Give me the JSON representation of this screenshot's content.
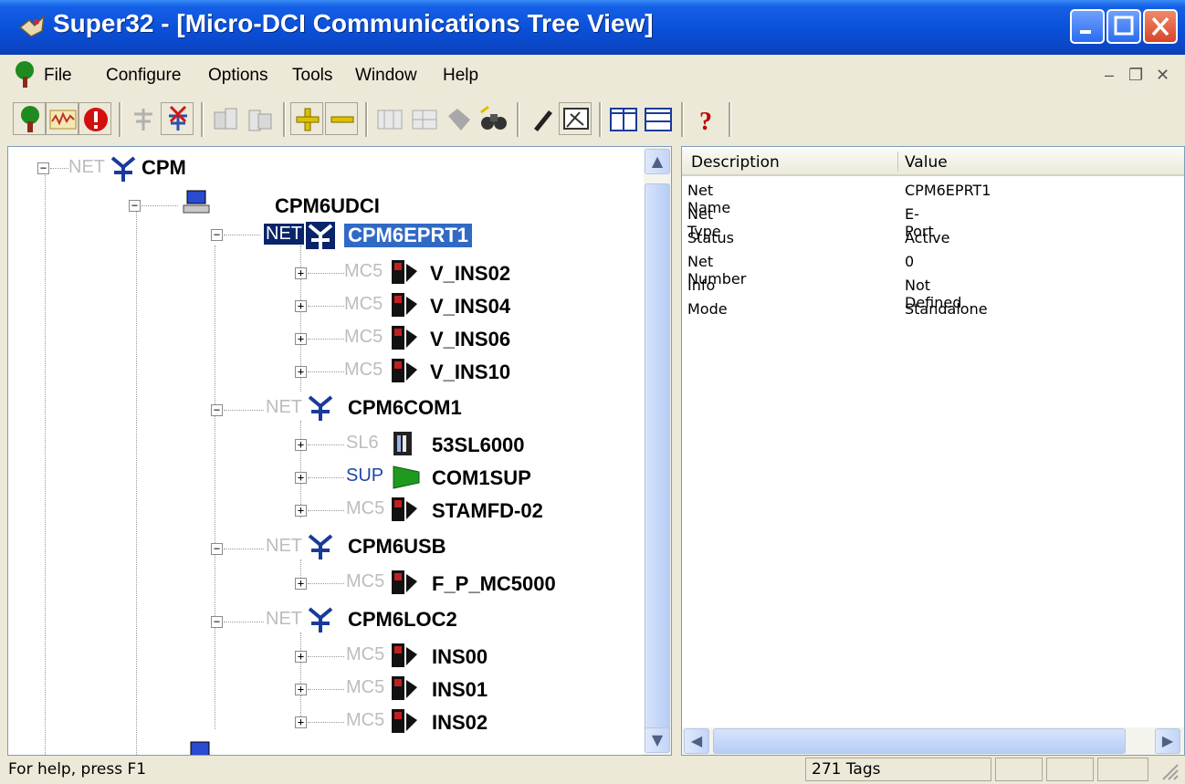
{
  "window": {
    "title": "Super32 - [Micro-DCI Communications Tree View]"
  },
  "menu": {
    "file": "File",
    "configure": "Configure",
    "options": "Options",
    "tools": "Tools",
    "window": "Window",
    "help": "Help"
  },
  "tree": {
    "root": {
      "tag": "NET",
      "label": "CPM"
    },
    "host": {
      "label": "CPM6UDCI"
    },
    "net1": {
      "tag": "NET",
      "label": "CPM6EPRT1"
    },
    "net1_children": [
      {
        "tag": "MC5",
        "label": "V_INS02"
      },
      {
        "tag": "MC5",
        "label": "V_INS04"
      },
      {
        "tag": "MC5",
        "label": "V_INS06"
      },
      {
        "tag": "MC5",
        "label": "V_INS10"
      }
    ],
    "net2": {
      "tag": "NET",
      "label": "CPM6COM1"
    },
    "net2_children": [
      {
        "tag": "SL6",
        "label": "53SL6000"
      },
      {
        "tag": "SUP",
        "label": "COM1SUP"
      },
      {
        "tag": "MC5",
        "label": "STAMFD-02"
      }
    ],
    "net3": {
      "tag": "NET",
      "label": "CPM6USB"
    },
    "net3_children": [
      {
        "tag": "MC5",
        "label": "F_P_MC5000"
      }
    ],
    "net4": {
      "tag": "NET",
      "label": "CPM6LOC2"
    },
    "net4_children": [
      {
        "tag": "MC5",
        "label": "INS00"
      },
      {
        "tag": "MC5",
        "label": "INS01"
      },
      {
        "tag": "MC5",
        "label": "INS02"
      }
    ]
  },
  "properties": {
    "headers": {
      "description": "Description",
      "value": "Value"
    },
    "rows": [
      {
        "description": "Net Name",
        "value": "CPM6EPRT1"
      },
      {
        "description": "Net Type",
        "value": "E-Port"
      },
      {
        "description": "Status",
        "value": "Active"
      },
      {
        "description": "Net Number",
        "value": "0"
      },
      {
        "description": "Info",
        "value": "Not Defined"
      },
      {
        "description": "Mode",
        "value": "Standalone"
      }
    ]
  },
  "status": {
    "help": "For help, press F1",
    "tags": "271 Tags"
  },
  "colors": {
    "title_blue": "#0a4fd8",
    "selection": "#316ac5",
    "menu_bg": "#ece9d8"
  }
}
